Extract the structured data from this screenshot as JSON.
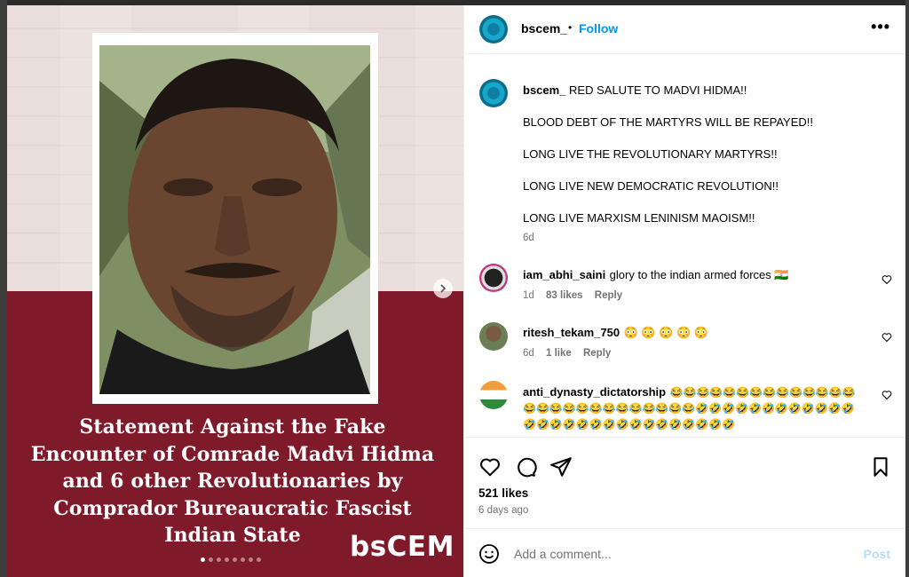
{
  "post": {
    "headline": "Statement Against the Fake Encounter of Comrade Madvi Hidma and 6 other Revolutionaries by Comprador Bureaucratic Fascist Indian State",
    "brand": "bsCEM",
    "slides_total": 8,
    "slide_active": 1
  },
  "header": {
    "username": "bscem_",
    "separator": "•",
    "follow_label": "Follow",
    "more_label": "•••"
  },
  "caption": {
    "username": "bscem_",
    "lines": [
      "RED SALUTE TO MADVI HIDMA!!",
      "BLOOD DEBT OF THE MARTYRS WILL BE REPAYED!!",
      "LONG LIVE THE REVOLUTIONARY MARTYRS!!",
      "LONG LIVE NEW DEMOCRATIC REVOLUTION!!",
      "LONG LIVE MARXISM LENINISM MAOISM!!"
    ],
    "time": "6d"
  },
  "comments": [
    {
      "username": "iam_abhi_saini",
      "text": "glory to the indian armed forces 🇮🇳",
      "time": "1d",
      "likes": "83 likes",
      "reply": "Reply"
    },
    {
      "username": "ritesh_tekam_750",
      "text": "😳 😳 😳 😳 😳",
      "time": "6d",
      "likes": "1 like",
      "reply": "Reply"
    },
    {
      "username": "anti_dynasty_dictatorship",
      "text": "😂😂😂😂😂😂😂😂😂😂😂😂😂😂😂😂😂😂😂😂😂😂😂😂😂😂😂🤣🤣🤣🤣🤣🤣🤣🤣🤣🤣🤣🤣🤣🤣🤣🤣🤣🤣🤣🤣🤣🤣🤣🤣🤣🤣🤣🤣"
    }
  ],
  "footer": {
    "likes": "521 likes",
    "time_ago": "6 days ago",
    "comment_placeholder": "Add a comment...",
    "post_label": "Post"
  },
  "colors": {
    "maroon": "#7f1a2b",
    "follow_blue": "#0095f6",
    "post_disabled": "#b2dffc"
  }
}
